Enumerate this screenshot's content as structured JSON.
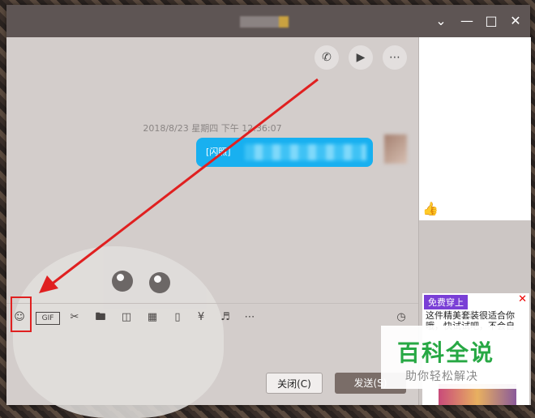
{
  "header": {
    "call_icon": "phone-icon",
    "video_icon": "video-camera-icon",
    "more_icon": "more-icon"
  },
  "chat": {
    "timestamp": "2018/8/23 星期四 下午 12:36:07",
    "message_prefix": "[闪照]"
  },
  "toolbar": {
    "gif_label": "GIF",
    "icons": [
      "emoji-icon",
      "gif-icon",
      "scissors-icon",
      "folder-icon",
      "image-gallery-icon",
      "picture-icon",
      "shake-icon",
      "red-packet-icon",
      "music-icon",
      "more-icon",
      "clock-icon"
    ]
  },
  "buttons": {
    "close_label": "关闭(C)",
    "send_label": "发送(S)"
  },
  "ad": {
    "badge": "免费穿上",
    "text_line1": "这件精美套装很适合你",
    "text_line2": "哦，快试试吧，不会自"
  },
  "watermark": {
    "main": "百科全说",
    "sub": "助你轻松解决"
  },
  "colors": {
    "bubble": "#18b0f0",
    "annotation": "#e02020",
    "watermark": "#27a844"
  }
}
